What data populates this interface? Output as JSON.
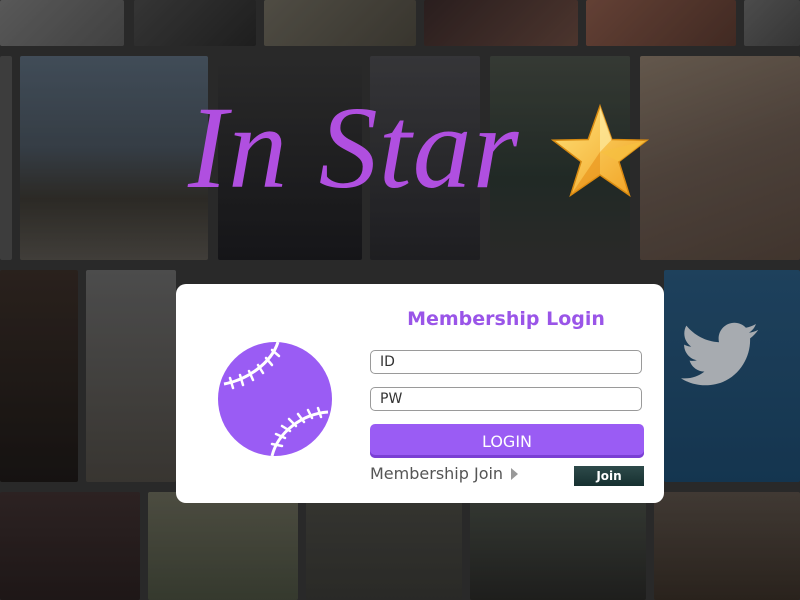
{
  "brand": {
    "name": "In Star",
    "color": "#b04fe0"
  },
  "login": {
    "title": "Membership Login",
    "id_placeholder": "ID",
    "pw_placeholder": "PW",
    "login_label": "LOGIN",
    "join_link_label": "Membership Join",
    "join_button_label": "Join",
    "accent_color": "#9a5cf4"
  },
  "background": {
    "description_icon": "photo-collage"
  }
}
